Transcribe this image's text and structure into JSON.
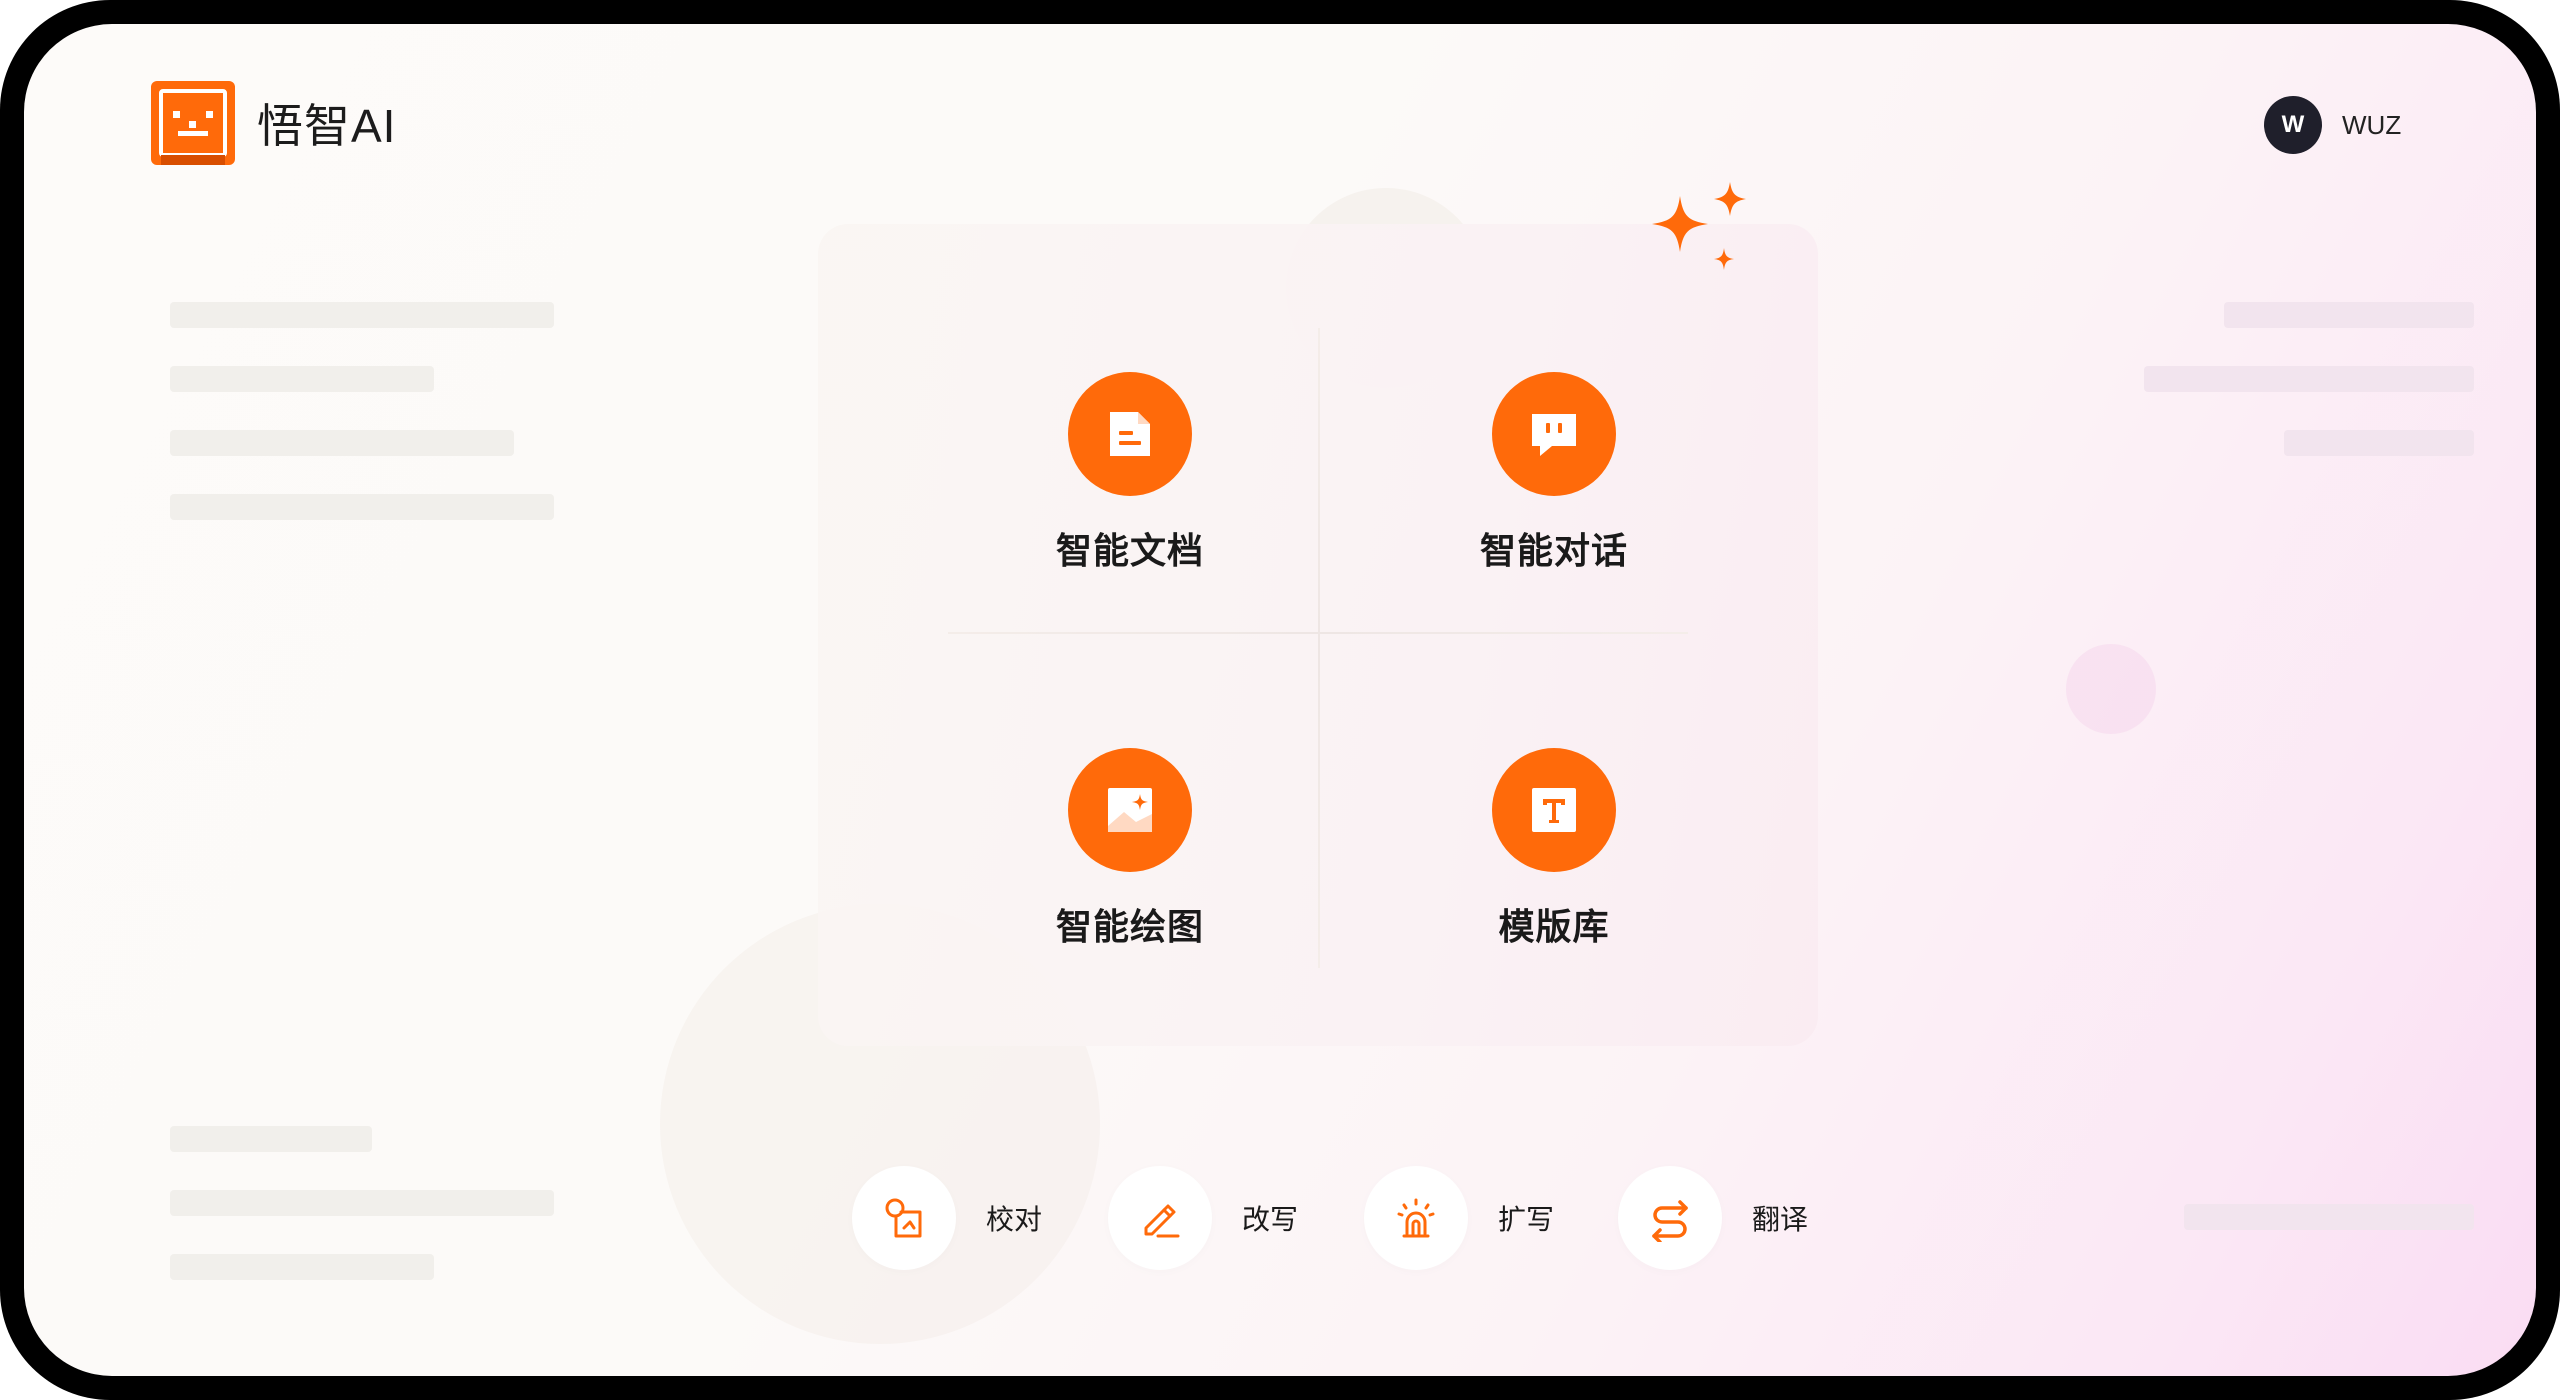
{
  "app": {
    "name": "悟智AI",
    "brand_color": "#ff6a0a"
  },
  "user": {
    "initial": "W",
    "name": "WUZ"
  },
  "features": [
    {
      "label": "智能文档",
      "icon": "document-icon"
    },
    {
      "label": "智能对话",
      "icon": "chat-icon"
    },
    {
      "label": "智能绘图",
      "icon": "image-icon"
    },
    {
      "label": "模版库",
      "icon": "template-icon"
    }
  ],
  "tools": [
    {
      "label": "校对",
      "icon": "proofread-icon"
    },
    {
      "label": "改写",
      "icon": "rewrite-icon"
    },
    {
      "label": "扩写",
      "icon": "expand-icon"
    },
    {
      "label": "翻译",
      "icon": "translate-icon"
    }
  ]
}
